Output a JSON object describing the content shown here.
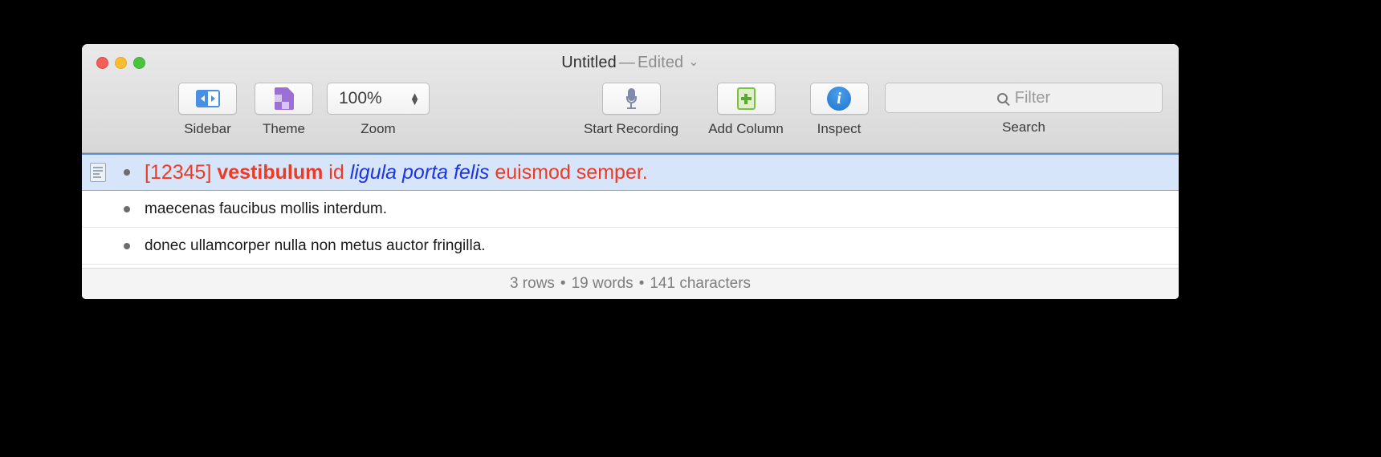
{
  "window": {
    "title_name": "Untitled",
    "title_dash": "—",
    "title_edited": "Edited",
    "title_chevron": "⌄",
    "traffic": {
      "close": "close-button",
      "minimize": "minimize-button",
      "maximize": "maximize-button"
    }
  },
  "toolbar": {
    "sidebar": {
      "label": "Sidebar",
      "icon": "sidebar-toggle-icon"
    },
    "theme": {
      "label": "Theme",
      "icon": "theme-page-icon"
    },
    "zoom": {
      "label": "Zoom",
      "value": "100%",
      "up": "▲",
      "down": "▼"
    },
    "record": {
      "label": "Start Recording",
      "icon": "microphone-icon"
    },
    "add_column": {
      "label": "Add Column",
      "icon": "add-column-icon"
    },
    "inspect": {
      "label": "Inspect",
      "icon": "info-icon",
      "glyph": "i"
    },
    "search": {
      "label": "Search",
      "placeholder": "Filter",
      "value": "",
      "icon": "search-icon"
    }
  },
  "rows": [
    {
      "selected": true,
      "has_icon": true,
      "segments": [
        {
          "text": "[12345] ",
          "style": "red"
        },
        {
          "text": "vestibulum",
          "style": "bold-red"
        },
        {
          "text": " id ",
          "style": "red"
        },
        {
          "text": "ligula porta felis",
          "style": "blue-italic"
        },
        {
          "text": " euismod semper.",
          "style": "red"
        }
      ]
    },
    {
      "selected": false,
      "has_icon": false,
      "segments": [
        {
          "text": "maecenas faucibus mollis interdum.",
          "style": "plain"
        }
      ]
    },
    {
      "selected": false,
      "has_icon": false,
      "segments": [
        {
          "text": "donec ullamcorper nulla non metus auctor fringilla.",
          "style": "plain"
        }
      ]
    }
  ],
  "statusbar": {
    "rows": "3 rows",
    "sep1": "•",
    "words": "19 words",
    "sep2": "•",
    "characters": "141 characters"
  },
  "colors": {
    "accent_red": "#ec3b24",
    "accent_blue": "#1c35e8",
    "selection": "#d7e5fa",
    "toolbar_bg": "#e0e0e0"
  }
}
